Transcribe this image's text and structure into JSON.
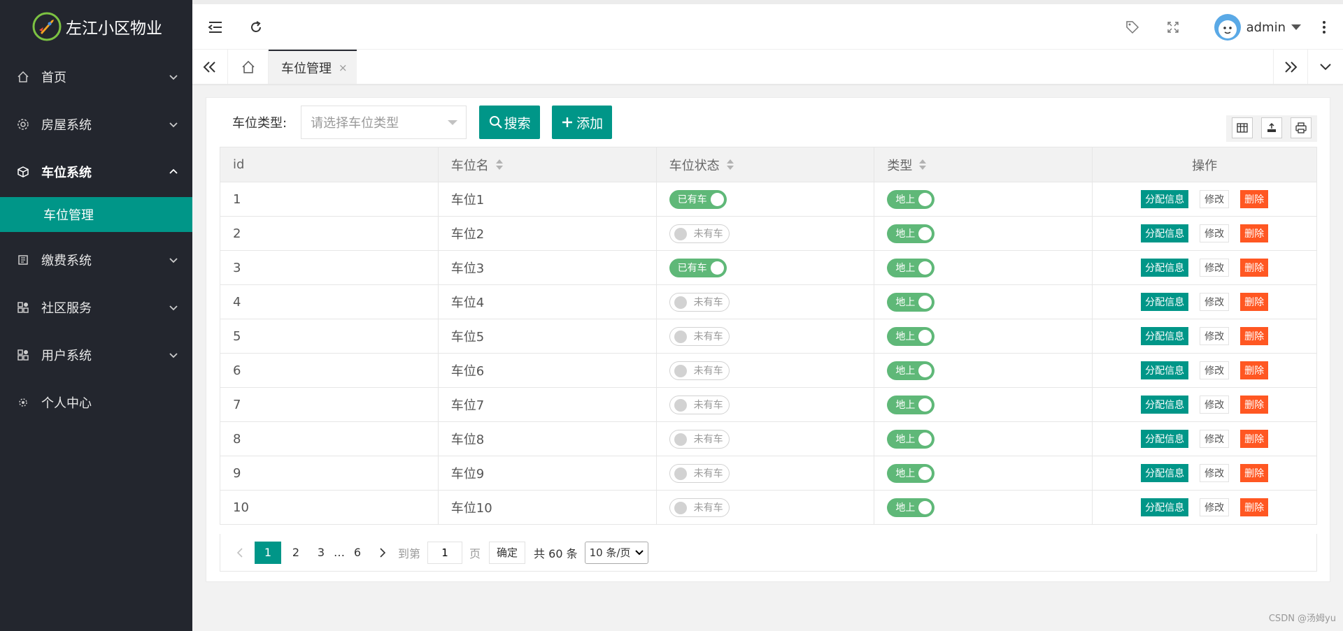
{
  "app": {
    "title": "左江小区物业"
  },
  "sidebar": {
    "items": [
      {
        "label": "首页",
        "icon": "home-icon"
      },
      {
        "label": "房屋系统",
        "icon": "gear-icon"
      },
      {
        "label": "车位系统",
        "icon": "box-icon"
      },
      {
        "label": "缴费系统",
        "icon": "book-icon"
      },
      {
        "label": "社区服务",
        "icon": "app-icon"
      },
      {
        "label": "用户系统",
        "icon": "app-icon"
      },
      {
        "label": "个人中心",
        "icon": "settings-icon"
      }
    ],
    "active_sub": "车位管理"
  },
  "header": {
    "user": "admin"
  },
  "tabs": [
    {
      "label": "车位管理",
      "close": "×"
    }
  ],
  "search": {
    "label": "车位类型:",
    "placeholder": "请选择车位类型",
    "search_btn": "搜索",
    "add_btn": "添加"
  },
  "table": {
    "headers": [
      "id",
      "车位名",
      "车位状态",
      "类型",
      "操作"
    ],
    "rows": [
      {
        "id": "1",
        "name": "车位1",
        "status": "已有车",
        "status_on": true,
        "type": "地上"
      },
      {
        "id": "2",
        "name": "车位2",
        "status": "未有车",
        "status_on": false,
        "type": "地上"
      },
      {
        "id": "3",
        "name": "车位3",
        "status": "已有车",
        "status_on": true,
        "type": "地上"
      },
      {
        "id": "4",
        "name": "车位4",
        "status": "未有车",
        "status_on": false,
        "type": "地上"
      },
      {
        "id": "5",
        "name": "车位5",
        "status": "未有车",
        "status_on": false,
        "type": "地上"
      },
      {
        "id": "6",
        "name": "车位6",
        "status": "未有车",
        "status_on": false,
        "type": "地上"
      },
      {
        "id": "7",
        "name": "车位7",
        "status": "未有车",
        "status_on": false,
        "type": "地上"
      },
      {
        "id": "8",
        "name": "车位8",
        "status": "未有车",
        "status_on": false,
        "type": "地上"
      },
      {
        "id": "9",
        "name": "车位9",
        "status": "未有车",
        "status_on": false,
        "type": "地上"
      },
      {
        "id": "10",
        "name": "车位10",
        "status": "未有车",
        "status_on": false,
        "type": "地上"
      }
    ],
    "actions": {
      "assign": "分配信息",
      "edit": "修改",
      "delete": "删除"
    }
  },
  "pager": {
    "pages": [
      "1",
      "2",
      "3",
      "…",
      "6"
    ],
    "current": "1",
    "goto_label": "到第",
    "goto_value": "1",
    "page_unit": "页",
    "confirm": "确定",
    "total": "共 60 条",
    "page_size": "10 条/页"
  },
  "watermark": "CSDN @汤姆yu",
  "colors": {
    "sidebar": "#23262e",
    "accent": "#009688",
    "switch_on": "#5fb878",
    "danger": "#ff5722"
  }
}
